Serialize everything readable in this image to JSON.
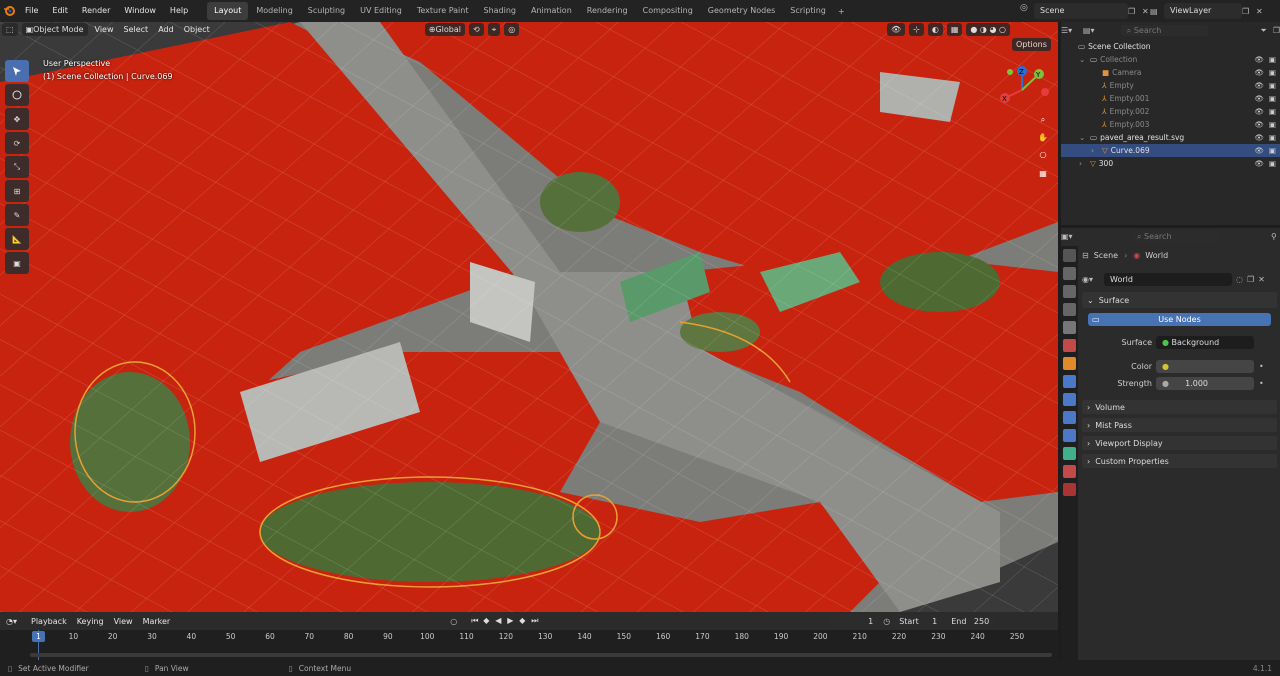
{
  "app": {
    "version": "4.1.1"
  },
  "topbar": {
    "menus": [
      "File",
      "Edit",
      "Render",
      "Window",
      "Help"
    ],
    "workspaces": [
      "Layout",
      "Modeling",
      "Sculpting",
      "UV Editing",
      "Texture Paint",
      "Shading",
      "Animation",
      "Rendering",
      "Compositing",
      "Geometry Nodes",
      "Scripting"
    ],
    "active_workspace": "Layout",
    "add_tab": "+",
    "scene": "Scene",
    "view_layer": "ViewLayer"
  },
  "viewport": {
    "mode": "Object Mode",
    "menus": [
      "View",
      "Select",
      "Add",
      "Object"
    ],
    "transform_orientation": "Global",
    "options": "Options",
    "info_line1": "User Perspective",
    "info_line2": "(1) Scene Collection | Curve.069",
    "gizmo": {
      "x": "X",
      "y": "Y",
      "z": "Z"
    }
  },
  "outliner": {
    "search_placeholder": "Search",
    "rows": [
      {
        "label": "Scene Collection",
        "depth": 0
      },
      {
        "label": "Collection",
        "depth": 1,
        "dim": true
      },
      {
        "label": "Camera",
        "depth": 2,
        "dim": true
      },
      {
        "label": "Empty",
        "depth": 2,
        "dim": true
      },
      {
        "label": "Empty.001",
        "depth": 2,
        "dim": true
      },
      {
        "label": "Empty.002",
        "depth": 2,
        "dim": true
      },
      {
        "label": "Empty.003",
        "depth": 2,
        "dim": true
      },
      {
        "label": "paved_area_result.svg",
        "depth": 1
      },
      {
        "label": "Curve.069",
        "depth": 2,
        "selected": true
      },
      {
        "label": "300",
        "depth": 1
      }
    ]
  },
  "properties": {
    "search_placeholder": "Search",
    "breadcrumb": [
      "Scene",
      "World"
    ],
    "world_name": "World",
    "surface_panel": "Surface",
    "use_nodes": "Use Nodes",
    "surface_label": "Surface",
    "surface_value": "Background",
    "color_label": "Color",
    "strength_label": "Strength",
    "strength_value": "1.000",
    "panels": [
      "Volume",
      "Mist Pass",
      "Viewport Display",
      "Custom Properties"
    ]
  },
  "timeline": {
    "menus": [
      "Playback",
      "Keying",
      "View",
      "Marker"
    ],
    "current_frame": "1",
    "start_label": "Start",
    "start": "1",
    "end_label": "End",
    "end": "250",
    "ticks": [
      "1",
      "10",
      "20",
      "30",
      "40",
      "50",
      "60",
      "70",
      "80",
      "90",
      "100",
      "110",
      "120",
      "130",
      "140",
      "150",
      "160",
      "170",
      "180",
      "190",
      "200",
      "210",
      "220",
      "230",
      "240",
      "250"
    ]
  },
  "statusbar": {
    "items": [
      "Set Active Modifier",
      "Pan View",
      "Context Menu"
    ]
  },
  "colors": {
    "accent": "#4772b3",
    "selected_row": "#334d80",
    "mask_red": "#c8230f",
    "outline_orange": "#e8a033"
  }
}
